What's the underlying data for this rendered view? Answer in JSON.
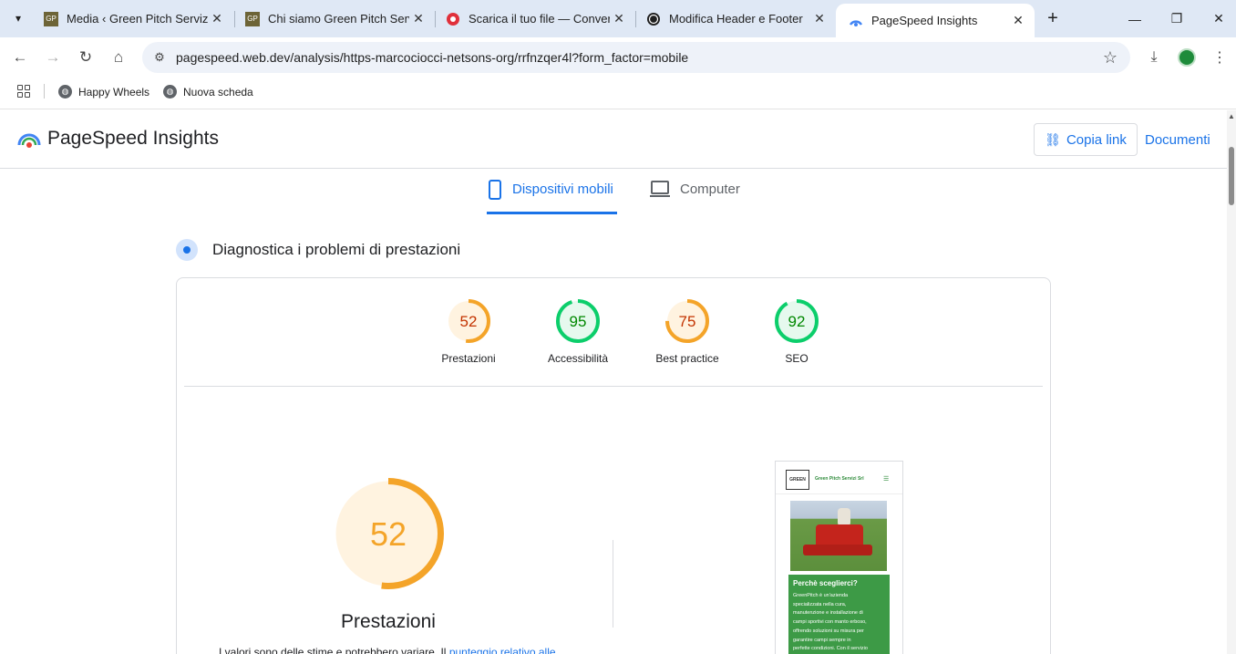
{
  "browser": {
    "tabs": [
      {
        "title": "Media ‹ Green Pitch Servizi S",
        "favicon": "gp-favicon",
        "active": false
      },
      {
        "title": "Chi siamo Green Pitch Servi",
        "favicon": "gp-favicon",
        "active": false
      },
      {
        "title": "Scarica il tuo file — Convert",
        "favicon": "convert-favicon",
        "active": false
      },
      {
        "title": "Modifica Header e Footer",
        "favicon": "wp-favicon",
        "active": false
      },
      {
        "title": "PageSpeed Insights",
        "favicon": "psi-favicon",
        "active": true
      }
    ],
    "url": "pagespeed.web.dev/analysis/https-marcociocci-netsons-org/rrfnzqer4l?form_factor=mobile",
    "bookmarks": [
      "Happy Wheels",
      "Nuova scheda"
    ]
  },
  "psi": {
    "title": "PageSpeed Insights",
    "copy_link": "Copia link",
    "docs": "Documenti",
    "device_tabs": {
      "mobile": "Dispositivi mobili",
      "desktop": "Computer"
    },
    "diagnostics_title": "Diagnostica i problemi di prestazioni",
    "scores": [
      {
        "label": "Prestazioni",
        "value": 52,
        "color": "#f4a429",
        "bg": "#fff3e0"
      },
      {
        "label": "Accessibilità",
        "value": 95,
        "color": "#0cce6b",
        "bg": "#e6f9ee"
      },
      {
        "label": "Best practice",
        "value": 75,
        "color": "#f4a429",
        "bg": "#fff3e0"
      },
      {
        "label": "SEO",
        "value": 92,
        "color": "#0cce6b",
        "bg": "#e6f9ee"
      }
    ],
    "main_score": {
      "label": "Prestazioni",
      "value": 52,
      "color": "#f4a429",
      "text_color": "#f4a429"
    },
    "note_text": "I valori sono delle stime e potrebbero variare. Il",
    "note_link": "punteggio relativo alle",
    "preview": {
      "logo": "GREEN",
      "brand": "Green Pitch Servizi Srl",
      "heading": "Perchè sceglierci?",
      "text": "GreenPitch è un'azienda\nspecializzata nella cura,\nmanutenzione e installazione di\ncampi sportivi con manto erboso,\noffrendo soluzioni su misura per\ngarantire campi sempre in\nperfette condizioni. Con il servizio"
    }
  }
}
